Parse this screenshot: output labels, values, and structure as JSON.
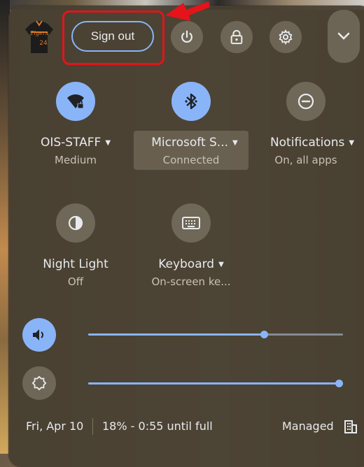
{
  "header": {
    "sign_out_label": "Sign out",
    "avatar_text": "Tigers"
  },
  "tiles": [
    {
      "label": "OIS-STAFF",
      "sub": "Medium",
      "icon": "wifi-locked-icon",
      "active": true
    },
    {
      "label": "Microsoft S...",
      "sub": "Connected",
      "icon": "bluetooth-icon",
      "active": true
    },
    {
      "label": "Notifications",
      "sub": "On, all apps",
      "icon": "do-not-disturb-icon",
      "active": false
    },
    {
      "label": "Night Light",
      "sub": "Off",
      "icon": "night-light-icon",
      "active": false
    },
    {
      "label": "Keyboard",
      "sub": "On-screen ke...",
      "icon": "keyboard-icon",
      "active": false
    }
  ],
  "sliders": {
    "volume_level": 0.7,
    "brightness_level": 1.0
  },
  "footer": {
    "date": "Fri, Apr 10",
    "battery": "18% - 0:55 until full",
    "managed": "Managed"
  },
  "colors": {
    "accent": "#8ab4f8",
    "highlight_border": "#e4141a"
  }
}
